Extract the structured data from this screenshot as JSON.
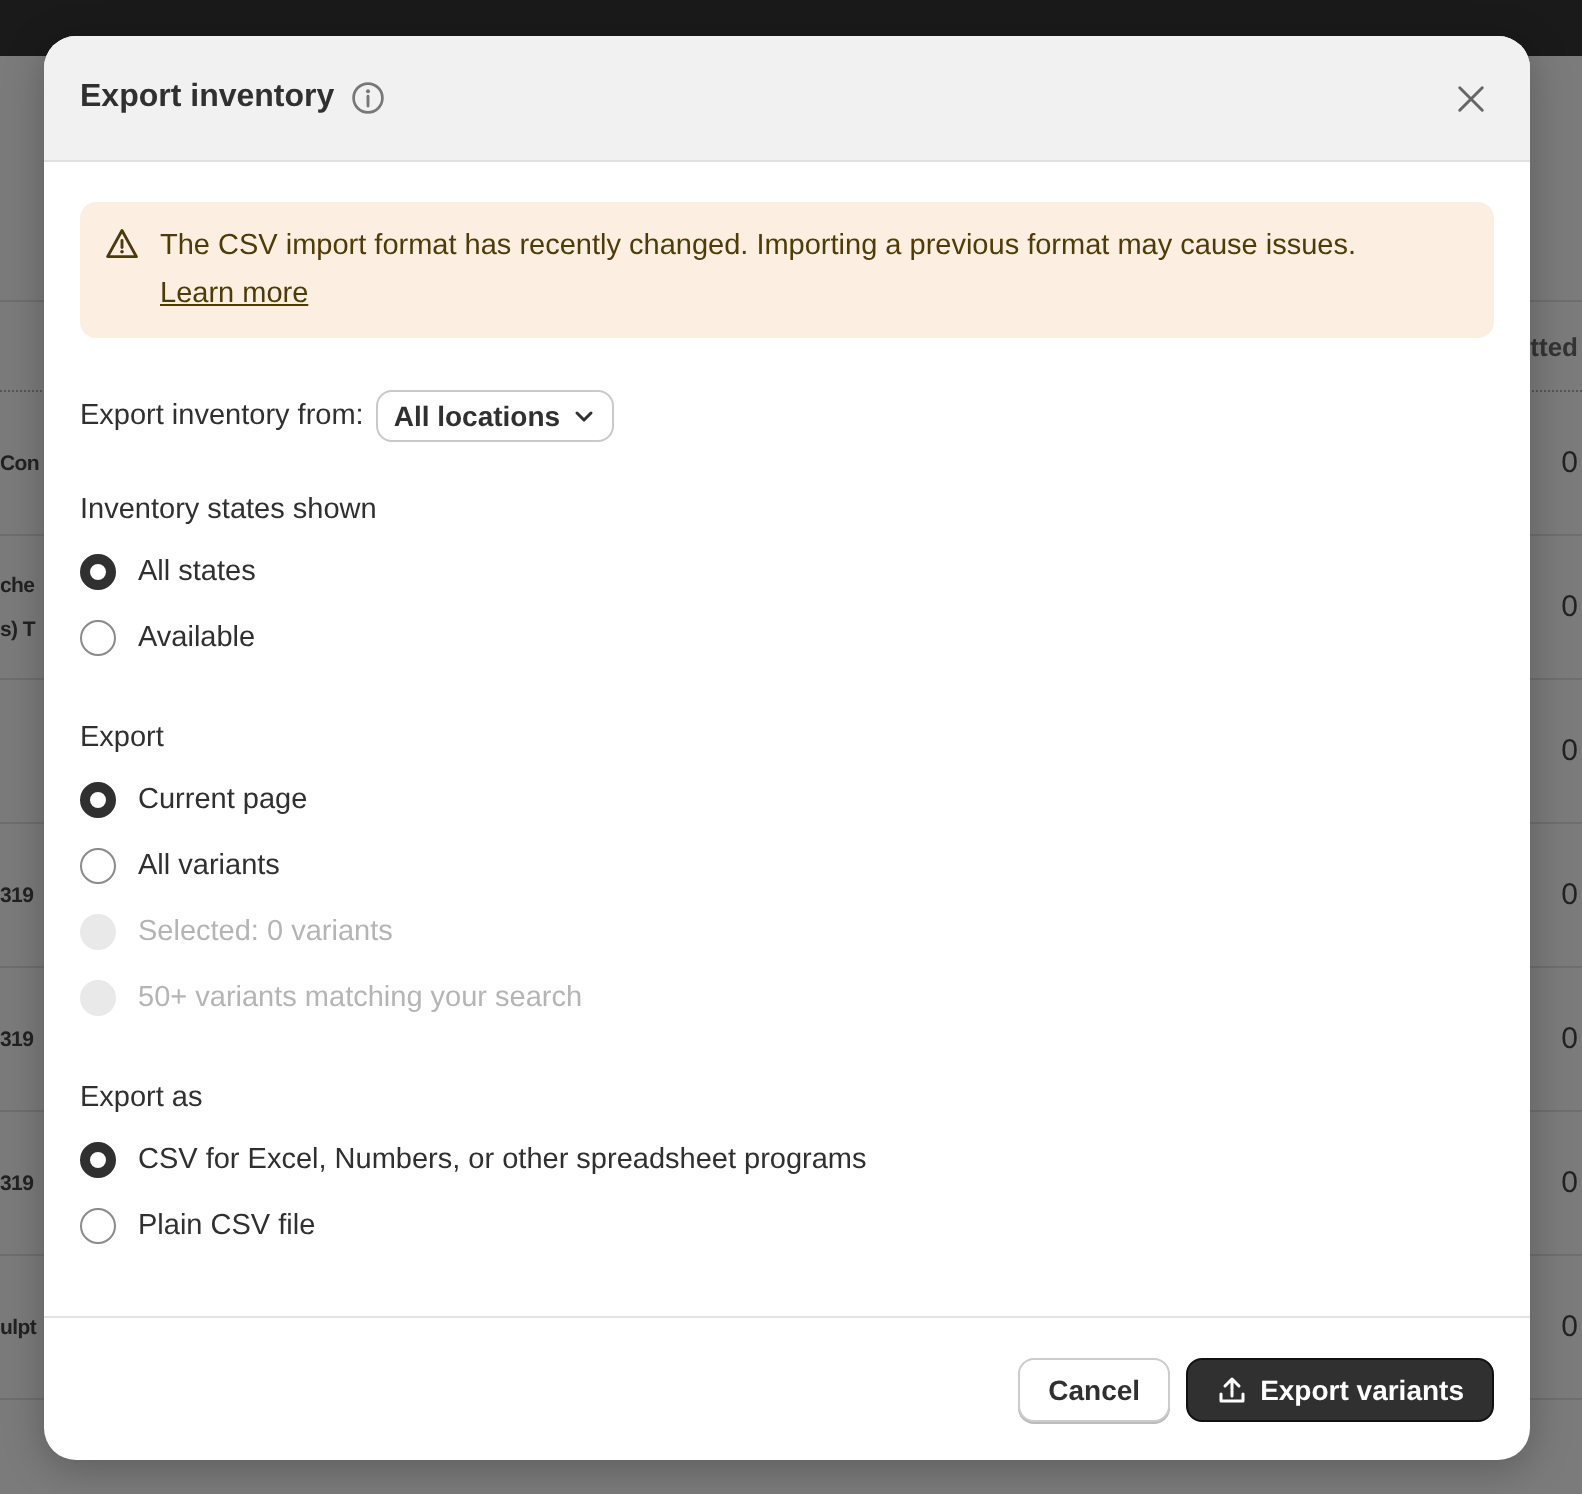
{
  "background": {
    "column_header": "tted",
    "rows": [
      {
        "name": "Con",
        "value": "0"
      },
      {
        "name": "che\ns) T",
        "value": "0"
      },
      {
        "name": "",
        "value": "0"
      },
      {
        "name": "319",
        "value": "0"
      },
      {
        "name": "319",
        "value": "0"
      },
      {
        "name": "319",
        "value": "0"
      },
      {
        "name": "ulpt",
        "value": "0"
      }
    ]
  },
  "dialog": {
    "title": "Export inventory",
    "banner": {
      "text": "The CSV import format has recently changed. Importing a previous format may cause issues.",
      "link": "Learn more"
    },
    "location": {
      "label": "Export inventory from:",
      "value": "All locations"
    },
    "groups": [
      {
        "title": "Inventory states shown",
        "options": [
          {
            "label": "All states",
            "selected": true,
            "disabled": false
          },
          {
            "label": "Available",
            "selected": false,
            "disabled": false
          }
        ]
      },
      {
        "title": "Export",
        "options": [
          {
            "label": "Current page",
            "selected": true,
            "disabled": false
          },
          {
            "label": "All variants",
            "selected": false,
            "disabled": false
          },
          {
            "label": "Selected: 0 variants",
            "selected": false,
            "disabled": true
          },
          {
            "label": "50+ variants matching your search",
            "selected": false,
            "disabled": true
          }
        ]
      },
      {
        "title": "Export as",
        "options": [
          {
            "label": "CSV for Excel, Numbers, or other spreadsheet programs",
            "selected": true,
            "disabled": false
          },
          {
            "label": "Plain CSV file",
            "selected": false,
            "disabled": false
          }
        ]
      }
    ],
    "buttons": [
      {
        "label": "Cancel",
        "kind": "secondary"
      },
      {
        "label": "Export variants",
        "kind": "primary"
      }
    ]
  }
}
